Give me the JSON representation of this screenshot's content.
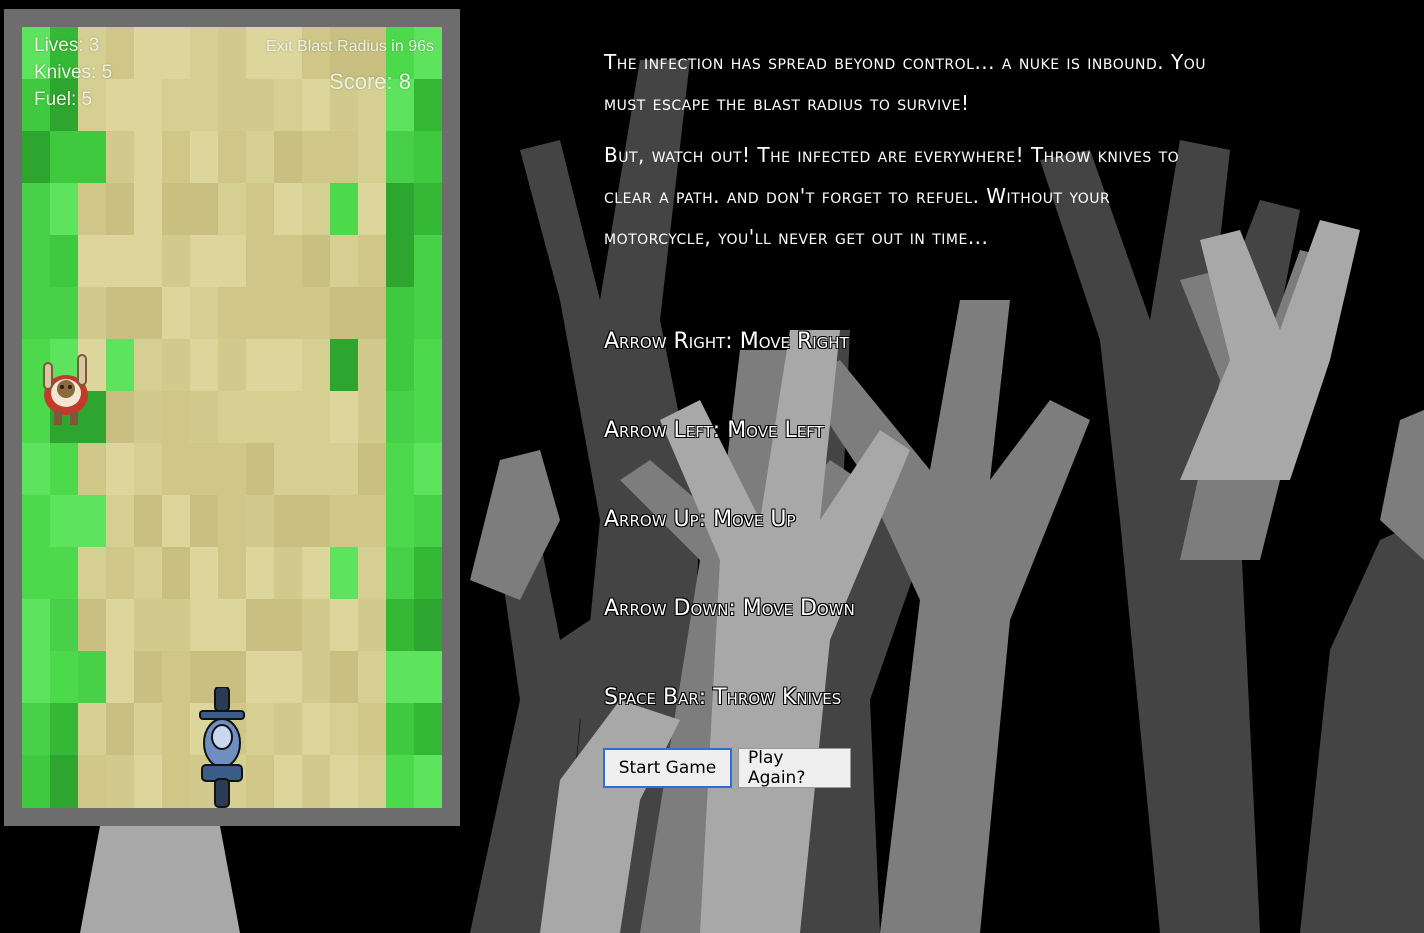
{
  "hud": {
    "lives": "Lives: 3",
    "knives": "Knives: 5",
    "fuel": "Fuel: 5",
    "timer": "Exit Blast Radius in 96s",
    "score": "Score: 8"
  },
  "game": {
    "lives": 3,
    "knives": 5,
    "fuel": 5,
    "seconds_remaining": 96,
    "score": 8
  },
  "instructions": {
    "intro_1": "The infection has spread beyond control... a nuke is inbound. You must escape the blast radius to survive!",
    "intro_2": "But, watch out! The infected are everywhere! Throw knives to clear a path. and don't forget to refuel. Without your motorcycle, you'll never get out in time..."
  },
  "controls": [
    {
      "label": "Arrow Right: Move Right"
    },
    {
      "label": "Arrow Left: Move Left"
    },
    {
      "label": "Arrow Up: Move Up"
    },
    {
      "label": "Arrow Down: Move Down"
    },
    {
      "label": "Space Bar: Throw Knives"
    }
  ],
  "buttons": {
    "start": "Start Game",
    "again": "Play Again?"
  },
  "colors": {
    "background": "#000000",
    "frame": "#6d6d6d",
    "grass": "#4cd94c",
    "sand": "#d6cf92",
    "text": "#ffffff",
    "button_focus": "#2e6ed6"
  }
}
